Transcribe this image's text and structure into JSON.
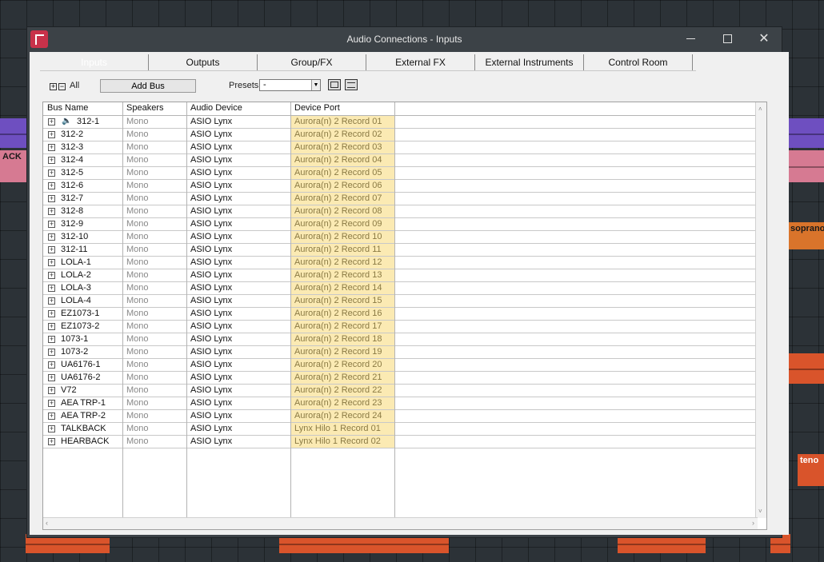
{
  "window": {
    "title": "Audio Connections - Inputs"
  },
  "tabs": [
    "Inputs",
    "Outputs",
    "Group/FX",
    "External FX",
    "External Instruments",
    "Control Room"
  ],
  "toolbar": {
    "all_label": "All",
    "add_bus_label": "Add Bus",
    "presets_label": "Presets",
    "presets_value": "-"
  },
  "table": {
    "headers": [
      "Bus Name",
      "Speakers",
      "Audio Device",
      "Device Port"
    ],
    "rows": [
      {
        "name": "312-1",
        "speakers": "Mono",
        "device": "ASIO Lynx",
        "port": "Aurora(n) 2 Record 01"
      },
      {
        "name": "312-2",
        "speakers": "Mono",
        "device": "ASIO Lynx",
        "port": "Aurora(n) 2 Record 02"
      },
      {
        "name": "312-3",
        "speakers": "Mono",
        "device": "ASIO Lynx",
        "port": "Aurora(n) 2 Record 03"
      },
      {
        "name": "312-4",
        "speakers": "Mono",
        "device": "ASIO Lynx",
        "port": "Aurora(n) 2 Record 04"
      },
      {
        "name": "312-5",
        "speakers": "Mono",
        "device": "ASIO Lynx",
        "port": "Aurora(n) 2 Record 05"
      },
      {
        "name": "312-6",
        "speakers": "Mono",
        "device": "ASIO Lynx",
        "port": "Aurora(n) 2 Record 06"
      },
      {
        "name": "312-7",
        "speakers": "Mono",
        "device": "ASIO Lynx",
        "port": "Aurora(n) 2 Record 07"
      },
      {
        "name": "312-8",
        "speakers": "Mono",
        "device": "ASIO Lynx",
        "port": "Aurora(n) 2 Record 08"
      },
      {
        "name": "312-9",
        "speakers": "Mono",
        "device": "ASIO Lynx",
        "port": "Aurora(n) 2 Record 09"
      },
      {
        "name": "312-10",
        "speakers": "Mono",
        "device": "ASIO Lynx",
        "port": "Aurora(n) 2 Record 10"
      },
      {
        "name": "312-11",
        "speakers": "Mono",
        "device": "ASIO Lynx",
        "port": "Aurora(n) 2 Record 11"
      },
      {
        "name": "LOLA-1",
        "speakers": "Mono",
        "device": "ASIO Lynx",
        "port": "Aurora(n) 2 Record 12"
      },
      {
        "name": "LOLA-2",
        "speakers": "Mono",
        "device": "ASIO Lynx",
        "port": "Aurora(n) 2 Record 13"
      },
      {
        "name": "LOLA-3",
        "speakers": "Mono",
        "device": "ASIO Lynx",
        "port": "Aurora(n) 2 Record 14"
      },
      {
        "name": "LOLA-4",
        "speakers": "Mono",
        "device": "ASIO Lynx",
        "port": "Aurora(n) 2 Record 15"
      },
      {
        "name": "EZ1073-1",
        "speakers": "Mono",
        "device": "ASIO Lynx",
        "port": "Aurora(n) 2 Record 16"
      },
      {
        "name": "EZ1073-2",
        "speakers": "Mono",
        "device": "ASIO Lynx",
        "port": "Aurora(n) 2 Record 17"
      },
      {
        "name": "1073-1",
        "speakers": "Mono",
        "device": "ASIO Lynx",
        "port": "Aurora(n) 2 Record 18"
      },
      {
        "name": "1073-2",
        "speakers": "Mono",
        "device": "ASIO Lynx",
        "port": "Aurora(n) 2 Record 19"
      },
      {
        "name": "UA6176-1",
        "speakers": "Mono",
        "device": "ASIO Lynx",
        "port": "Aurora(n) 2 Record 20"
      },
      {
        "name": "UA6176-2",
        "speakers": "Mono",
        "device": "ASIO Lynx",
        "port": "Aurora(n) 2 Record 21"
      },
      {
        "name": "V72",
        "speakers": "Mono",
        "device": "ASIO Lynx",
        "port": "Aurora(n) 2 Record 22"
      },
      {
        "name": "AEA TRP-1",
        "speakers": "Mono",
        "device": "ASIO Lynx",
        "port": "Aurora(n) 2 Record 23"
      },
      {
        "name": "AEA TRP-2",
        "speakers": "Mono",
        "device": "ASIO Lynx",
        "port": "Aurora(n) 2 Record 24"
      },
      {
        "name": "TALKBACK",
        "speakers": "Mono",
        "device": "ASIO Lynx",
        "port": "Lynx Hilo 1 Record 01"
      },
      {
        "name": "HEARBACK",
        "speakers": "Mono",
        "device": "ASIO Lynx",
        "port": "Lynx Hilo 1 Record 02"
      }
    ]
  },
  "background_clips": {
    "back_label": "ACK",
    "soprano_label": "soprano",
    "tenor_label": "teno"
  },
  "colors": {
    "port_highlight": "#fbeab3",
    "app_icon": "#c8324a",
    "clip_orange": "#d9542b",
    "clip_purple": "#7a55c8",
    "clip_pink": "#d46a8a"
  }
}
